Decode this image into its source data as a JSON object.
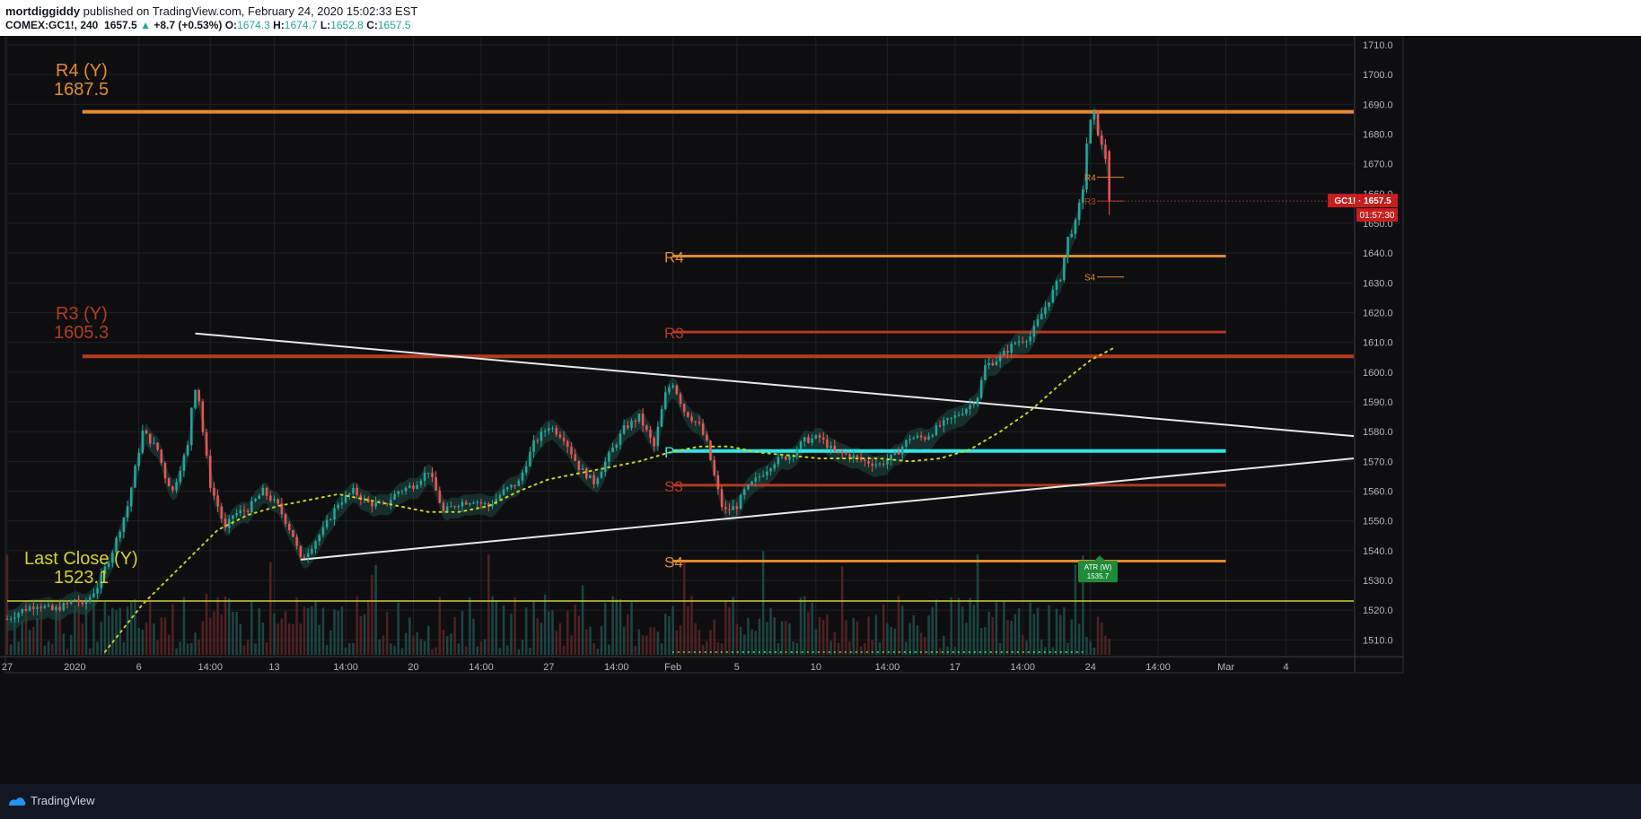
{
  "header": {
    "author": "mortdiggiddy",
    "published": "published on TradingView.com, February 24, 2020 15:02:33 EST",
    "symbol": "COMEX:GC1!, 240",
    "last": "1657.5",
    "arrow": "▲",
    "change": "+8.7 (+0.53%)",
    "o_label": "O:",
    "o_val": "1674.3",
    "h_label": "H:",
    "h_val": "1674.7",
    "l_label": "L:",
    "l_val": "1652.8",
    "c_label": "C:",
    "c_val": "1657.5"
  },
  "footer": {
    "brand": "TradingView",
    "logo_icon": "tradingview-logo-icon"
  },
  "colors": {
    "background": "#0e0e11",
    "grid": "#1e2026",
    "up": "#26a69a",
    "down": "#ef5350",
    "orange": "#e38a2e",
    "darkred": "#b43a22",
    "yellow": "#d4d22a",
    "cyan": "#2ee6e6",
    "white": "#e8e8e8",
    "sma": "#c8d41f"
  },
  "chart_data": {
    "type": "candlestick",
    "symbol": "COMEX:GC1!, 240",
    "ylim": [
      1505,
      1713
    ],
    "y_ticks": [
      "1510.0",
      "1520.0",
      "1530.0",
      "1540.0",
      "1550.0",
      "1560.0",
      "1570.0",
      "1580.0",
      "1590.0",
      "1600.0",
      "1610.0",
      "1620.0",
      "1630.0",
      "1640.0",
      "1650.0",
      "1660.0",
      "1670.0",
      "1680.0",
      "1690.0",
      "1700.0",
      "1710.0"
    ],
    "x_ticks": [
      {
        "label": "27",
        "t": 0
      },
      {
        "label": "2020",
        "t": 4.5
      },
      {
        "label": "6",
        "t": 8.75
      },
      {
        "label": "14:00",
        "t": 13.5
      },
      {
        "label": "13",
        "t": 17.75
      },
      {
        "label": "14:00",
        "t": 22.5
      },
      {
        "label": "20",
        "t": 27
      },
      {
        "label": "14:00",
        "t": 31.5
      },
      {
        "label": "27",
        "t": 36
      },
      {
        "label": "14:00",
        "t": 40.5
      },
      {
        "label": "Feb",
        "t": 44.25
      },
      {
        "label": "5",
        "t": 48.5
      },
      {
        "label": "10",
        "t": 53.75
      },
      {
        "label": "14:00",
        "t": 58.5
      },
      {
        "label": "17",
        "t": 63
      },
      {
        "label": "14:00",
        "t": 67.5
      },
      {
        "label": "24",
        "t": 72
      },
      {
        "label": "14:00",
        "t": 76.5
      },
      {
        "label": "Mar",
        "t": 81
      },
      {
        "label": "4",
        "t": 85
      }
    ],
    "xlim": [
      0,
      89.5
    ],
    "last_price": {
      "label": "GC1! · 1657.5",
      "countdown": "01:57:30",
      "value": 1657.5
    },
    "anchors": [
      [
        0,
        1517
      ],
      [
        1,
        1520
      ],
      [
        2,
        1522
      ],
      [
        3,
        1520
      ],
      [
        4,
        1522
      ],
      [
        4.6,
        1524
      ],
      [
        5,
        1521
      ],
      [
        6,
        1528
      ],
      [
        7,
        1540
      ],
      [
        8,
        1555
      ],
      [
        9,
        1580
      ],
      [
        10,
        1574
      ],
      [
        10.5,
        1565
      ],
      [
        11,
        1560
      ],
      [
        11.5,
        1568
      ],
      [
        12,
        1575
      ],
      [
        12.3,
        1591
      ],
      [
        12.6,
        1597
      ],
      [
        13,
        1580
      ],
      [
        13.5,
        1562
      ],
      [
        14,
        1555
      ],
      [
        14.5,
        1547
      ],
      [
        15,
        1552
      ],
      [
        16,
        1554
      ],
      [
        17,
        1560
      ],
      [
        18,
        1555
      ],
      [
        19,
        1545
      ],
      [
        19.5,
        1537
      ],
      [
        20,
        1540
      ],
      [
        21,
        1547
      ],
      [
        22,
        1556
      ],
      [
        23,
        1560
      ],
      [
        24,
        1556
      ],
      [
        25,
        1555
      ],
      [
        26,
        1560
      ],
      [
        27,
        1562
      ],
      [
        28,
        1567
      ],
      [
        29,
        1553
      ],
      [
        30,
        1556
      ],
      [
        31,
        1557
      ],
      [
        32,
        1555
      ],
      [
        33,
        1560
      ],
      [
        34,
        1563
      ],
      [
        35,
        1576
      ],
      [
        36,
        1582
      ],
      [
        37,
        1578
      ],
      [
        38,
        1568
      ],
      [
        39,
        1563
      ],
      [
        40,
        1572
      ],
      [
        41,
        1581
      ],
      [
        42,
        1585
      ],
      [
        43,
        1575
      ],
      [
        43.7,
        1592
      ],
      [
        44.2,
        1597
      ],
      [
        45,
        1587
      ],
      [
        46,
        1582
      ],
      [
        46.5,
        1576
      ],
      [
        47,
        1565
      ],
      [
        47.6,
        1553
      ],
      [
        48.5,
        1555
      ],
      [
        49,
        1560
      ],
      [
        50,
        1565
      ],
      [
        51,
        1570
      ],
      [
        52,
        1572
      ],
      [
        53,
        1577
      ],
      [
        54,
        1578
      ],
      [
        55,
        1573
      ],
      [
        56,
        1572
      ],
      [
        57,
        1570
      ],
      [
        58,
        1569
      ],
      [
        59,
        1572
      ],
      [
        60,
        1578
      ],
      [
        61,
        1578
      ],
      [
        62,
        1582
      ],
      [
        63,
        1585
      ],
      [
        64,
        1589
      ],
      [
        64.5,
        1592
      ],
      [
        65,
        1602
      ],
      [
        66,
        1605
      ],
      [
        67,
        1610
      ],
      [
        68,
        1612
      ],
      [
        69,
        1622
      ],
      [
        70,
        1632
      ],
      [
        70.5,
        1645
      ],
      [
        71,
        1650
      ],
      [
        71.5,
        1662
      ],
      [
        71.8,
        1680
      ],
      [
        72.2,
        1688
      ],
      [
        72.6,
        1678
      ],
      [
        73,
        1672
      ],
      [
        73.3,
        1657.5
      ]
    ],
    "sma_curve": [
      [
        6.5,
        1506
      ],
      [
        9,
        1522
      ],
      [
        12,
        1537
      ],
      [
        14,
        1547
      ],
      [
        16,
        1552
      ],
      [
        18,
        1555
      ],
      [
        20,
        1557
      ],
      [
        22,
        1559
      ],
      [
        24,
        1557
      ],
      [
        26,
        1555
      ],
      [
        28,
        1553
      ],
      [
        30,
        1553
      ],
      [
        32,
        1555
      ],
      [
        34,
        1560
      ],
      [
        36,
        1564
      ],
      [
        38,
        1566
      ],
      [
        40,
        1568
      ],
      [
        42,
        1570
      ],
      [
        44,
        1573
      ],
      [
        46,
        1575
      ],
      [
        48,
        1575
      ],
      [
        50,
        1573
      ],
      [
        52,
        1572
      ],
      [
        54,
        1571
      ],
      [
        56,
        1571
      ],
      [
        58,
        1571
      ],
      [
        60,
        1570
      ],
      [
        62,
        1571
      ],
      [
        64,
        1574
      ],
      [
        66,
        1580
      ],
      [
        68,
        1587
      ],
      [
        70,
        1596
      ],
      [
        72,
        1604
      ],
      [
        73.5,
        1608
      ]
    ],
    "trendlines": [
      {
        "name": "descending-resistance",
        "from": [
          12.5,
          1613
        ],
        "to": [
          89.5,
          1578.5
        ]
      },
      {
        "name": "ascending-support",
        "from": [
          19.5,
          1537
        ],
        "to": [
          89.5,
          1571
        ]
      }
    ],
    "levels": [
      {
        "name": "R4 (Y)",
        "value": 1687.5,
        "color": "#e38a2e",
        "from": 5,
        "to": 89.5
      },
      {
        "name": "R3 (Y)",
        "value": 1605.3,
        "color": "#b43a22",
        "from": 5,
        "to": 89.5
      },
      {
        "name": "Last Close (Y)",
        "value": 1523.1,
        "color": "#d4d22a",
        "from": 0,
        "to": 89.5
      },
      {
        "name": "R4",
        "value": 1639,
        "color": "#e38a2e",
        "from": 44.2,
        "to": 81
      },
      {
        "name": "R3",
        "value": 1613.5,
        "color": "#b43a22",
        "from": 44.2,
        "to": 81
      },
      {
        "name": "P",
        "value": 1573.5,
        "color": "#2ee6e6",
        "from": 44.2,
        "to": 81
      },
      {
        "name": "S3",
        "value": 1562,
        "color": "#b43a22",
        "from": 44.2,
        "to": 81
      },
      {
        "name": "S4",
        "value": 1536.5,
        "color": "#e38a2e",
        "from": 44.2,
        "to": 81
      }
    ],
    "labels": {
      "r4y_name": "R4 (Y)",
      "r4y_val": "1687.5",
      "r3y_name": "R3 (Y)",
      "r3y_val": "1605.3",
      "lcy_name": "Last Close (Y)",
      "lcy_val": "1523.1",
      "r4": "R4",
      "r3": "R3",
      "p": "P",
      "s3": "S3",
      "s4": "S4",
      "r4_small": "R4",
      "r3_small": "R3",
      "s4_small": "S4",
      "atr_name": "ATR (W)",
      "atr_val": "1535.7"
    }
  }
}
